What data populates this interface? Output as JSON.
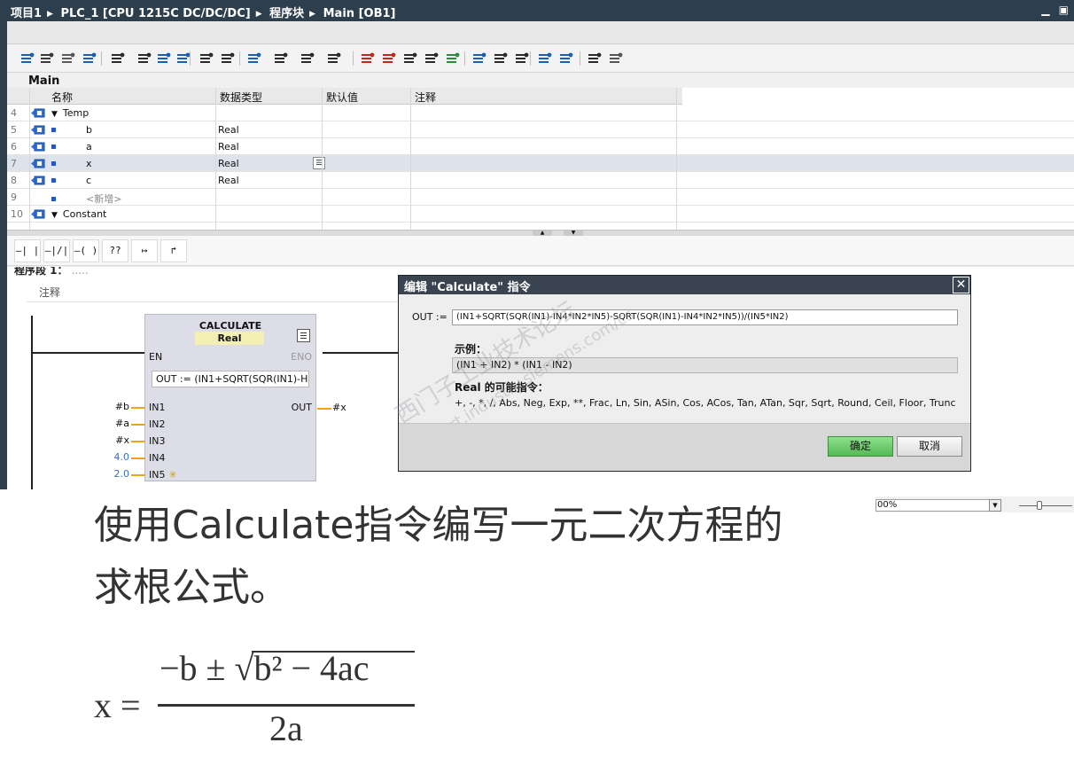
{
  "titlebar": {
    "crumbs": [
      "项目1",
      "PLC_1 [CPU 1215C DC/DC/DC]",
      "程序块",
      "Main [OB1]"
    ],
    "minimize": "▁",
    "restore": "▣"
  },
  "editor": {
    "block_title": "Main",
    "toolbar_icons": [
      "insert-network-icon",
      "delete-network-icon",
      "insert-row-icon",
      "add-row-icon",
      "open-all-icon",
      "close-all-icon",
      "display-favorites-icon",
      "symbolic-operand-icon",
      "absolute-operand-icon",
      "comment-icon",
      "shared-db-icon",
      "instance-db-icon",
      "move-up-icon",
      "move-down-icon",
      "goto-error-icon",
      "goto-next-icon",
      "next-error-icon",
      "monitor-icon",
      "online-icon",
      "offline-icon",
      "compare-icon",
      "snapshot-icon",
      "load-icon",
      "glasses-icon",
      "key-icon",
      "memory-card-icon"
    ],
    "table": {
      "headers": [
        "名称",
        "数据类型",
        "默认值",
        "注释"
      ],
      "rows": [
        {
          "num": "4",
          "name": "Temp",
          "type": "",
          "kind": "section"
        },
        {
          "num": "5",
          "name": "b",
          "type": "Real",
          "kind": "var"
        },
        {
          "num": "6",
          "name": "a",
          "type": "Real",
          "kind": "var"
        },
        {
          "num": "7",
          "name": "x",
          "type": "Real",
          "kind": "var",
          "selected": true
        },
        {
          "num": "8",
          "name": "c",
          "type": "Real",
          "kind": "var"
        },
        {
          "num": "9",
          "name": "<新增>",
          "type": "",
          "kind": "placeholder"
        },
        {
          "num": "10",
          "name": "Constant",
          "type": "",
          "kind": "section"
        }
      ]
    },
    "lad_buttons": [
      "—| |—",
      "—|/|—",
      "—( )—",
      "??",
      "↦",
      "↱"
    ],
    "network": {
      "title": "程序段 1：",
      "title_suffix": ".....",
      "comment": "注释",
      "block": {
        "name": "CALCULATE",
        "type": "Real",
        "en": "EN",
        "eno": "ENO",
        "expression": "OUT :=   (IN1+SQRT(SQR(IN1)-H...",
        "out_pin": "OUT",
        "out_param": "#x",
        "inputs": [
          {
            "pin": "IN1",
            "param": "#b",
            "const": false
          },
          {
            "pin": "IN2",
            "param": "#a",
            "const": false
          },
          {
            "pin": "IN3",
            "param": "#x",
            "const": false
          },
          {
            "pin": "IN4",
            "param": "4.0",
            "const": true
          },
          {
            "pin": "IN5",
            "param": "2.0",
            "const": true
          }
        ],
        "add_input_star": "✳"
      }
    }
  },
  "dialog": {
    "title": "编辑 \"Calculate\" 指令",
    "close": "✕",
    "out_label": "OUT :=",
    "out_value": "(IN1+SQRT(SQR(IN1)-IN4*IN2*IN5)-SQRT(SQR(IN1)-IN4*IN2*IN5))/(IN5*IN2)",
    "example_title": "示例：",
    "example_value": "(IN1 + IN2) * (IN1 - IN2)",
    "instructions_title": "Real 的可能指令：",
    "instructions": "+, -, *, /, Abs, Neg, Exp, **, Frac, Ln, Sin, ASin, Cos, ACos, Tan, ATan, Sqr, Sqrt, Round, Ceil, Floor, Trunc",
    "ok": "确定",
    "cancel": "取消",
    "watermark1": "西门子工业技术论坛",
    "watermark2": "support.industry.siemens.com/cs"
  },
  "zoom": {
    "value": "00%",
    "dropdown": "▼"
  },
  "caption": {
    "line1": "使用Calculate指令编写一元二次方程的",
    "line2": "求根公式。"
  },
  "formula": {
    "lhs": "x =",
    "numerator": "−b ± √b² − 4ac",
    "denominator": "2a"
  },
  "colors": {
    "titlebar": "#2d3e4d",
    "dialog_title": "#3a4451",
    "ok_button": "#55b955",
    "wire": "#f0a31c",
    "constant": "#3a6fc4"
  }
}
